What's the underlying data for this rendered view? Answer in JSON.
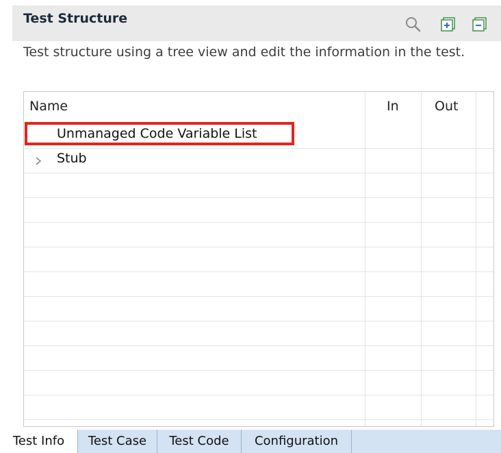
{
  "panel": {
    "title": "Test Structure",
    "description": "Test structure using a tree view and edit the information in the test.",
    "icons": [
      "search-icon",
      "expand-all-icon",
      "collapse-all-icon"
    ]
  },
  "tree": {
    "columns": [
      "Name",
      "In",
      "Out"
    ],
    "rows": [
      {
        "label": "Unmanaged Code Variable List",
        "expandable": false,
        "highlighted": true
      },
      {
        "label": "Stub",
        "expandable": true,
        "highlighted": false
      }
    ]
  },
  "tabs": [
    {
      "label": "Test Info",
      "active": true
    },
    {
      "label": "Test Case",
      "active": false
    },
    {
      "label": "Test Code",
      "active": false
    },
    {
      "label": "Configuration",
      "active": false
    }
  ],
  "colors": {
    "highlight_border": "#e5231d",
    "header_bg": "#eaeaea",
    "tabbar_bg": "#d3e3f3",
    "icon_green": "#3f8f4a"
  }
}
